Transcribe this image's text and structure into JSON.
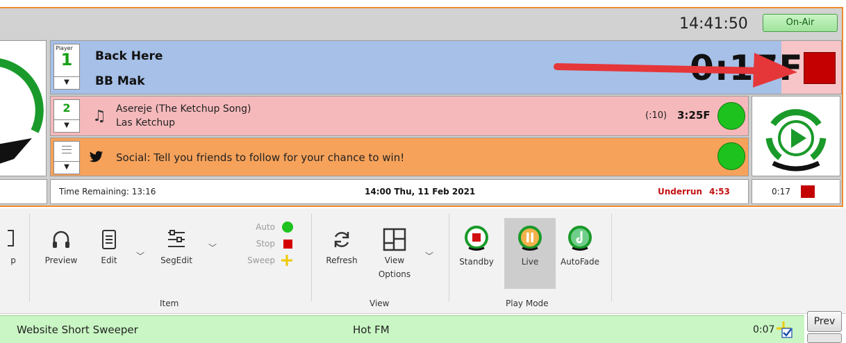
{
  "header": {
    "clock": "14:41:50",
    "onair_label": "On-Air"
  },
  "player1": {
    "selector_caption": "Player",
    "selector_number": "1",
    "title": "Back Here",
    "artist": "BB Mak",
    "timer": "0:17F"
  },
  "player2": {
    "selector_number": "2",
    "title": "Asereje (The Ketchup Song)",
    "artist": "Las Ketchup",
    "intro": "(:10)",
    "duration": "3:25F"
  },
  "player3": {
    "text": "Social: Tell you friends to follow for your chance to win!"
  },
  "status": {
    "remaining": "Time Remaining: 13:16",
    "datetime": "14:00 Thu, 11 Feb 2021",
    "underrun_label": "Underrun",
    "underrun_value": "4:53",
    "right_time": "0:17"
  },
  "ribbon": {
    "partial_label": "p",
    "preview": "Preview",
    "edit": "Edit",
    "segedit": "SegEdit",
    "auto": "Auto",
    "stop": "Stop",
    "sweep": "Sweep",
    "refresh": "Refresh",
    "view_options_line1": "View",
    "view_options_line2": "Options",
    "standby": "Standby",
    "live": "Live",
    "autofade": "AutoFade",
    "group_item": "Item",
    "group_view": "View",
    "group_playmode": "Play Mode"
  },
  "log": {
    "title": "Website Short Sweeper",
    "station": "Hot FM",
    "duration": "0:07",
    "prev_label": "Prev"
  },
  "colors": {
    "accent_orange": "#f08a2a",
    "player1_blue": "#a6c0e8",
    "player2_pink": "#f5b9bc",
    "player3_orange": "#f6a25a",
    "status_green": "#1ec21e",
    "stop_red": "#c40000",
    "arrow_red": "#e5363a"
  }
}
